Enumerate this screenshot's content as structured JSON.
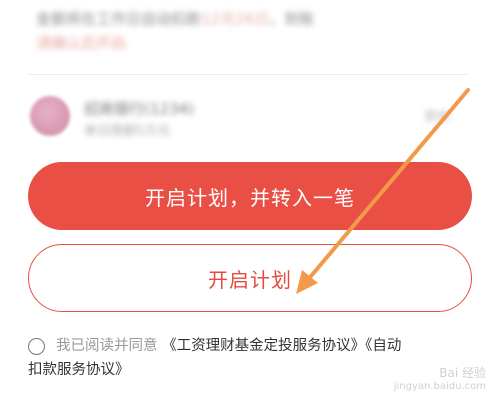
{
  "blurred_info": {
    "line1_left": "金额将在工作日自动扣款",
    "line1_right": "，到账",
    "line2": "请确认后开启"
  },
  "account": {
    "name": "招商银行(1234)",
    "detail": "单日限额5万元",
    "right_hint": "更换"
  },
  "buttons": {
    "primary_label": "开启计划，并转入一笔",
    "secondary_label": "开启计划"
  },
  "agreement": {
    "prefix": "我已阅读并同意",
    "link1": "《工资理财基金定投服务协议》",
    "link2_part1": "《自动",
    "link2_part2": "扣款服务协议》",
    "checked": false
  },
  "watermark": {
    "line1": "Bai 经验",
    "line2": "jingyan.baidu.com"
  },
  "colors": {
    "accent": "#ea4f45",
    "annotation_arrow": "#f39a4a"
  }
}
